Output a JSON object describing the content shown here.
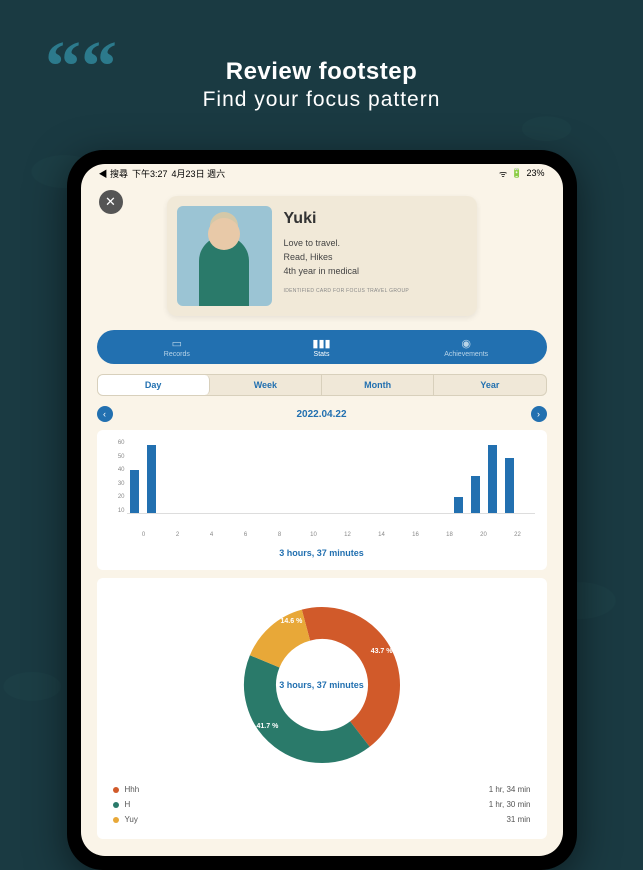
{
  "promo": {
    "quote": "““",
    "line1": "Review footstep",
    "line2": "Find your focus pattern"
  },
  "status": {
    "search": "◀ 搜尋",
    "time": "下午3:27",
    "date": "4月23日 週六",
    "battery": "23%"
  },
  "close": "✕",
  "profile": {
    "name": "Yuki",
    "line1": "Love to travel.",
    "line2": "Read, Hikes",
    "line3": "4th year in medical",
    "footer": "IDENTIFIED CARD FOR FOCUS TRAVEL GROUP"
  },
  "primary_tabs": {
    "records": "Records",
    "stats": "Stats",
    "achievements": "Achievements"
  },
  "secondary_tabs": {
    "day": "Day",
    "week": "Week",
    "month": "Month",
    "year": "Year"
  },
  "date_nav": {
    "prev": "‹",
    "date": "2022.04.22",
    "next": "›"
  },
  "chart_data": [
    {
      "type": "bar",
      "title": "3 hours, 37 minutes",
      "x": [
        0,
        2,
        4,
        6,
        8,
        10,
        12,
        14,
        16,
        18,
        20,
        22
      ],
      "values": [
        35,
        55,
        0,
        0,
        0,
        0,
        0,
        0,
        0,
        0,
        13,
        30,
        55,
        45
      ],
      "ylim": [
        0,
        60
      ],
      "yticks": [
        60,
        50,
        40,
        30,
        20,
        10
      ],
      "xlabel": "",
      "ylabel": ""
    },
    {
      "type": "pie",
      "title": "3 hours, 37 minutes",
      "series": [
        {
          "name": "Hhh",
          "value": 43.7,
          "color": "#d15a2a",
          "time": "1 hr, 34 min"
        },
        {
          "name": "H",
          "value": 41.7,
          "color": "#2a7a6a",
          "time": "1 hr, 30 min"
        },
        {
          "name": "Yuy",
          "value": 14.6,
          "color": "#e8a838",
          "time": "31 min"
        }
      ]
    }
  ]
}
